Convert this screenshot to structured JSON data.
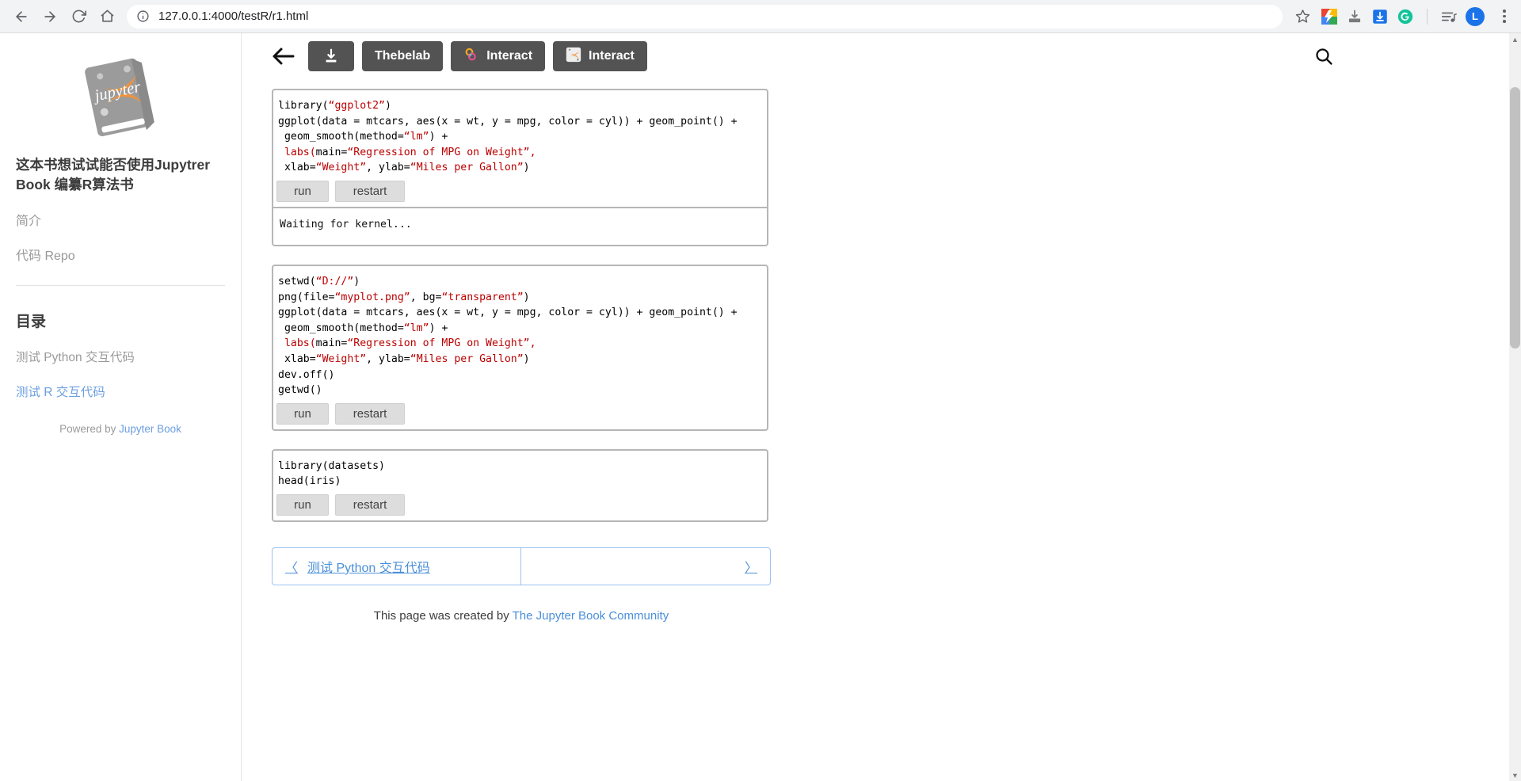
{
  "browser": {
    "url": "127.0.0.1:4000/testR/r1.html",
    "back_icon": "back-arrow-icon",
    "forward_icon": "forward-arrow-icon",
    "reload_icon": "reload-icon",
    "home_icon": "home-icon",
    "site_info_icon": "info-circle-icon",
    "star_icon": "star-icon",
    "avatar_label": "L",
    "extensions": [
      {
        "name": "colorful-extension-icon"
      },
      {
        "name": "download-manager-icon"
      },
      {
        "name": "blue-save-icon"
      },
      {
        "name": "grammarly-icon"
      },
      {
        "name": "playlist-icon"
      }
    ]
  },
  "sidebar": {
    "logo_alt": "jupyter-book-logo",
    "book_title": "这本书想试试能否使用Jupytrer Book 编纂R算法书",
    "links": [
      {
        "label": "简介"
      },
      {
        "label": "代码 Repo"
      }
    ],
    "toc_heading": "目录",
    "toc_items": [
      {
        "label": "测试 Python 交互代码",
        "active": false
      },
      {
        "label": "测试 R 交互代码",
        "active": true
      }
    ],
    "powered_prefix": "Powered by ",
    "powered_link": "Jupyter Book"
  },
  "toolbar": {
    "back_label": "back",
    "download_label": "download",
    "thebelab_label": "Thebelab",
    "interact_binder_label": "Interact",
    "interact_jupyter_label": "Interact",
    "search_label": "search"
  },
  "cells": [
    {
      "id": "cell-1",
      "code_lines": [
        [
          {
            "t": "library(",
            "c": "plain"
          },
          {
            "t": "“ggplot2”",
            "c": "str"
          },
          {
            "t": ")",
            "c": "plain"
          }
        ],
        [
          {
            "t": "ggplot(data = mtcars, aes(x = wt, y = mpg, color = cyl)) + geom_point() +",
            "c": "plain"
          }
        ],
        [
          {
            "t": " geom_smooth(method=",
            "c": "plain"
          },
          {
            "t": "“lm”",
            "c": "str"
          },
          {
            "t": ") +",
            "c": "plain"
          }
        ],
        [
          {
            "t": " labs(",
            "c": "fn-red"
          },
          {
            "t": "main=",
            "c": "plain"
          },
          {
            "t": "“Regression of MPG on Weight”,",
            "c": "str"
          }
        ],
        [
          {
            "t": " xlab=",
            "c": "plain"
          },
          {
            "t": "“Weight”",
            "c": "str"
          },
          {
            "t": ", ylab=",
            "c": "plain"
          },
          {
            "t": "“Miles per Gallon”",
            "c": "str"
          },
          {
            "t": ")",
            "c": "plain"
          }
        ]
      ],
      "run_label": "run",
      "restart_label": "restart",
      "output": "Waiting for kernel..."
    },
    {
      "id": "cell-2",
      "code_lines": [
        [
          {
            "t": "setwd(",
            "c": "plain"
          },
          {
            "t": "“D://”",
            "c": "str"
          },
          {
            "t": ")",
            "c": "plain"
          }
        ],
        [
          {
            "t": "png(file=",
            "c": "plain"
          },
          {
            "t": "“myplot.png”",
            "c": "str"
          },
          {
            "t": ", bg=",
            "c": "plain"
          },
          {
            "t": "“transparent”",
            "c": "str"
          },
          {
            "t": ")",
            "c": "plain"
          }
        ],
        [
          {
            "t": "ggplot(data = mtcars, aes(x = wt, y = mpg, color = cyl)) + geom_point() +",
            "c": "plain"
          }
        ],
        [
          {
            "t": " geom_smooth(method=",
            "c": "plain"
          },
          {
            "t": "“lm”",
            "c": "str"
          },
          {
            "t": ") +",
            "c": "plain"
          }
        ],
        [
          {
            "t": " labs(",
            "c": "fn-red"
          },
          {
            "t": "main=",
            "c": "plain"
          },
          {
            "t": "“Regression of MPG on Weight”,",
            "c": "str"
          }
        ],
        [
          {
            "t": " xlab=",
            "c": "plain"
          },
          {
            "t": "“Weight”",
            "c": "str"
          },
          {
            "t": ", ylab=",
            "c": "plain"
          },
          {
            "t": "“Miles per Gallon”",
            "c": "str"
          },
          {
            "t": ")",
            "c": "plain"
          }
        ],
        [
          {
            "t": "dev.off()",
            "c": "plain"
          }
        ],
        [
          {
            "t": "getwd()",
            "c": "plain"
          }
        ]
      ],
      "run_label": "run",
      "restart_label": "restart",
      "output": null
    },
    {
      "id": "cell-3",
      "code_lines": [
        [
          {
            "t": "library(datasets)",
            "c": "plain"
          }
        ],
        [
          {
            "t": "head(iris)",
            "c": "plain"
          }
        ]
      ],
      "run_label": "run",
      "restart_label": "restart",
      "output": null
    }
  ],
  "pagenav": {
    "prev_arrow": "〈",
    "prev_label": "测试 Python 交互代码",
    "next_arrow": "〉",
    "next_label": ""
  },
  "footer": {
    "text_prefix": "This page was created by ",
    "link": "The Jupyter Book Community"
  },
  "colors": {
    "accent_blue": "#4a8fd8",
    "button_dark": "#535353",
    "string_red": "#bb0000"
  }
}
